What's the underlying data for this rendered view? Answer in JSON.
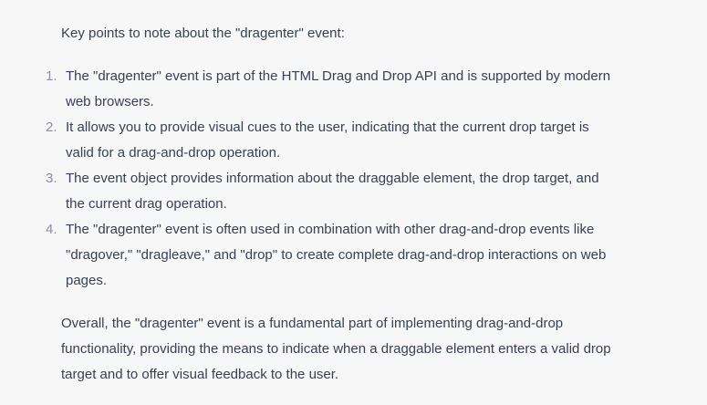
{
  "message": {
    "intro": "Key points to note about the \"dragenter\" event:",
    "items": [
      {
        "num": "1.",
        "text": "The \"dragenter\" event is part of the HTML Drag and Drop API and is supported by modern\nweb browsers."
      },
      {
        "num": "2.",
        "text": "It allows you to provide visual cues to the user, indicating that the current drop target is\nvalid for a drag-and-drop operation."
      },
      {
        "num": "3.",
        "text": "The event object provides information about the draggable element, the drop target, and\nthe current drag operation."
      },
      {
        "num": "4.",
        "text": "The \"dragenter\" event is often used in combination with other drag-and-drop events like\n\"dragover,\" \"dragleave,\" and \"drop\" to create complete drag-and-drop interactions on web\npages."
      }
    ],
    "outro": "Overall, the \"dragenter\" event is a fundamental part of implementing drag-and-drop\nfunctionality, providing the means to indicate when a draggable element enters a valid drop\ntarget and to offer visual feedback to the user."
  }
}
